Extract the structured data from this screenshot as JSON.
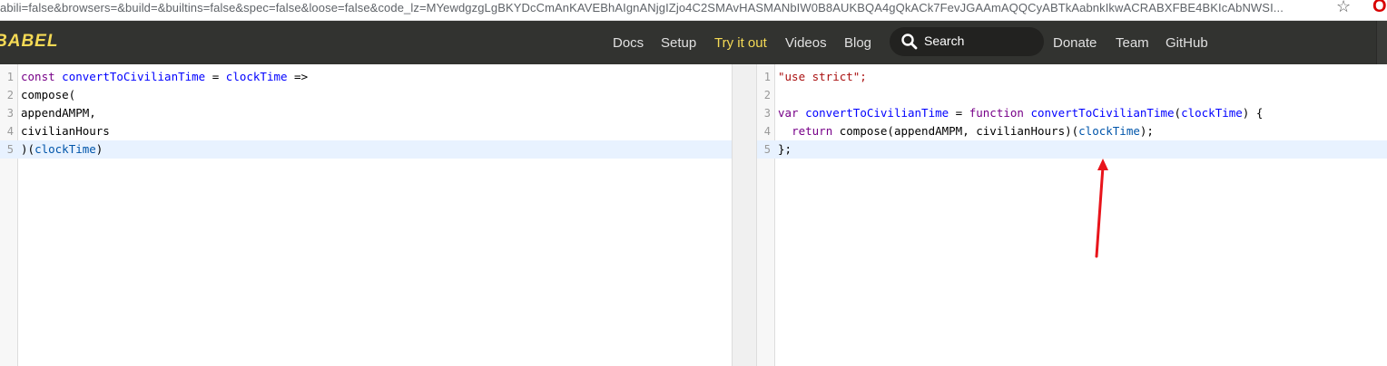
{
  "browser": {
    "url": "abili=false&browsers=&build=&builtins=false&spec=false&loose=false&code_lz=MYewdgzgLgBKYDcCmAnKAVEBhAIgnANjgIZjo4C2SMAvHASMANbIW0B8AUKBQA4gQkACk7FevJGAAmAQQCyABTkAabnkIkwACRABXFBE4BKIcAbNWSI..."
  },
  "header": {
    "logo": "BABEL",
    "nav": [
      "Docs",
      "Setup",
      "Try it out",
      "Videos",
      "Blog"
    ],
    "active": "Try it out",
    "search_placeholder": "Search",
    "nav_right": [
      "Donate",
      "Team",
      "GitHub"
    ]
  },
  "editor_input": {
    "lines": [
      {
        "n": "1",
        "text": "const convertToCivilianTime = clockTime =>"
      },
      {
        "n": "2",
        "text": "compose("
      },
      {
        "n": "3",
        "text": "appendAMPM,"
      },
      {
        "n": "4",
        "text": "civilianHours"
      },
      {
        "n": "5",
        "text": ")(clockTime)"
      }
    ]
  },
  "editor_output": {
    "lines": [
      {
        "n": "1",
        "text": "\"use strict\";"
      },
      {
        "n": "2",
        "text": ""
      },
      {
        "n": "3",
        "text": "var convertToCivilianTime = function convertToCivilianTime(clockTime) {"
      },
      {
        "n": "4",
        "text": "  return compose(appendAMPM, civilianHours)(clockTime);"
      },
      {
        "n": "5",
        "text": "};"
      }
    ]
  },
  "colors": {
    "header_bg": "#323330",
    "accent": "#f5da55",
    "annotation_arrow": "#e8141b"
  }
}
